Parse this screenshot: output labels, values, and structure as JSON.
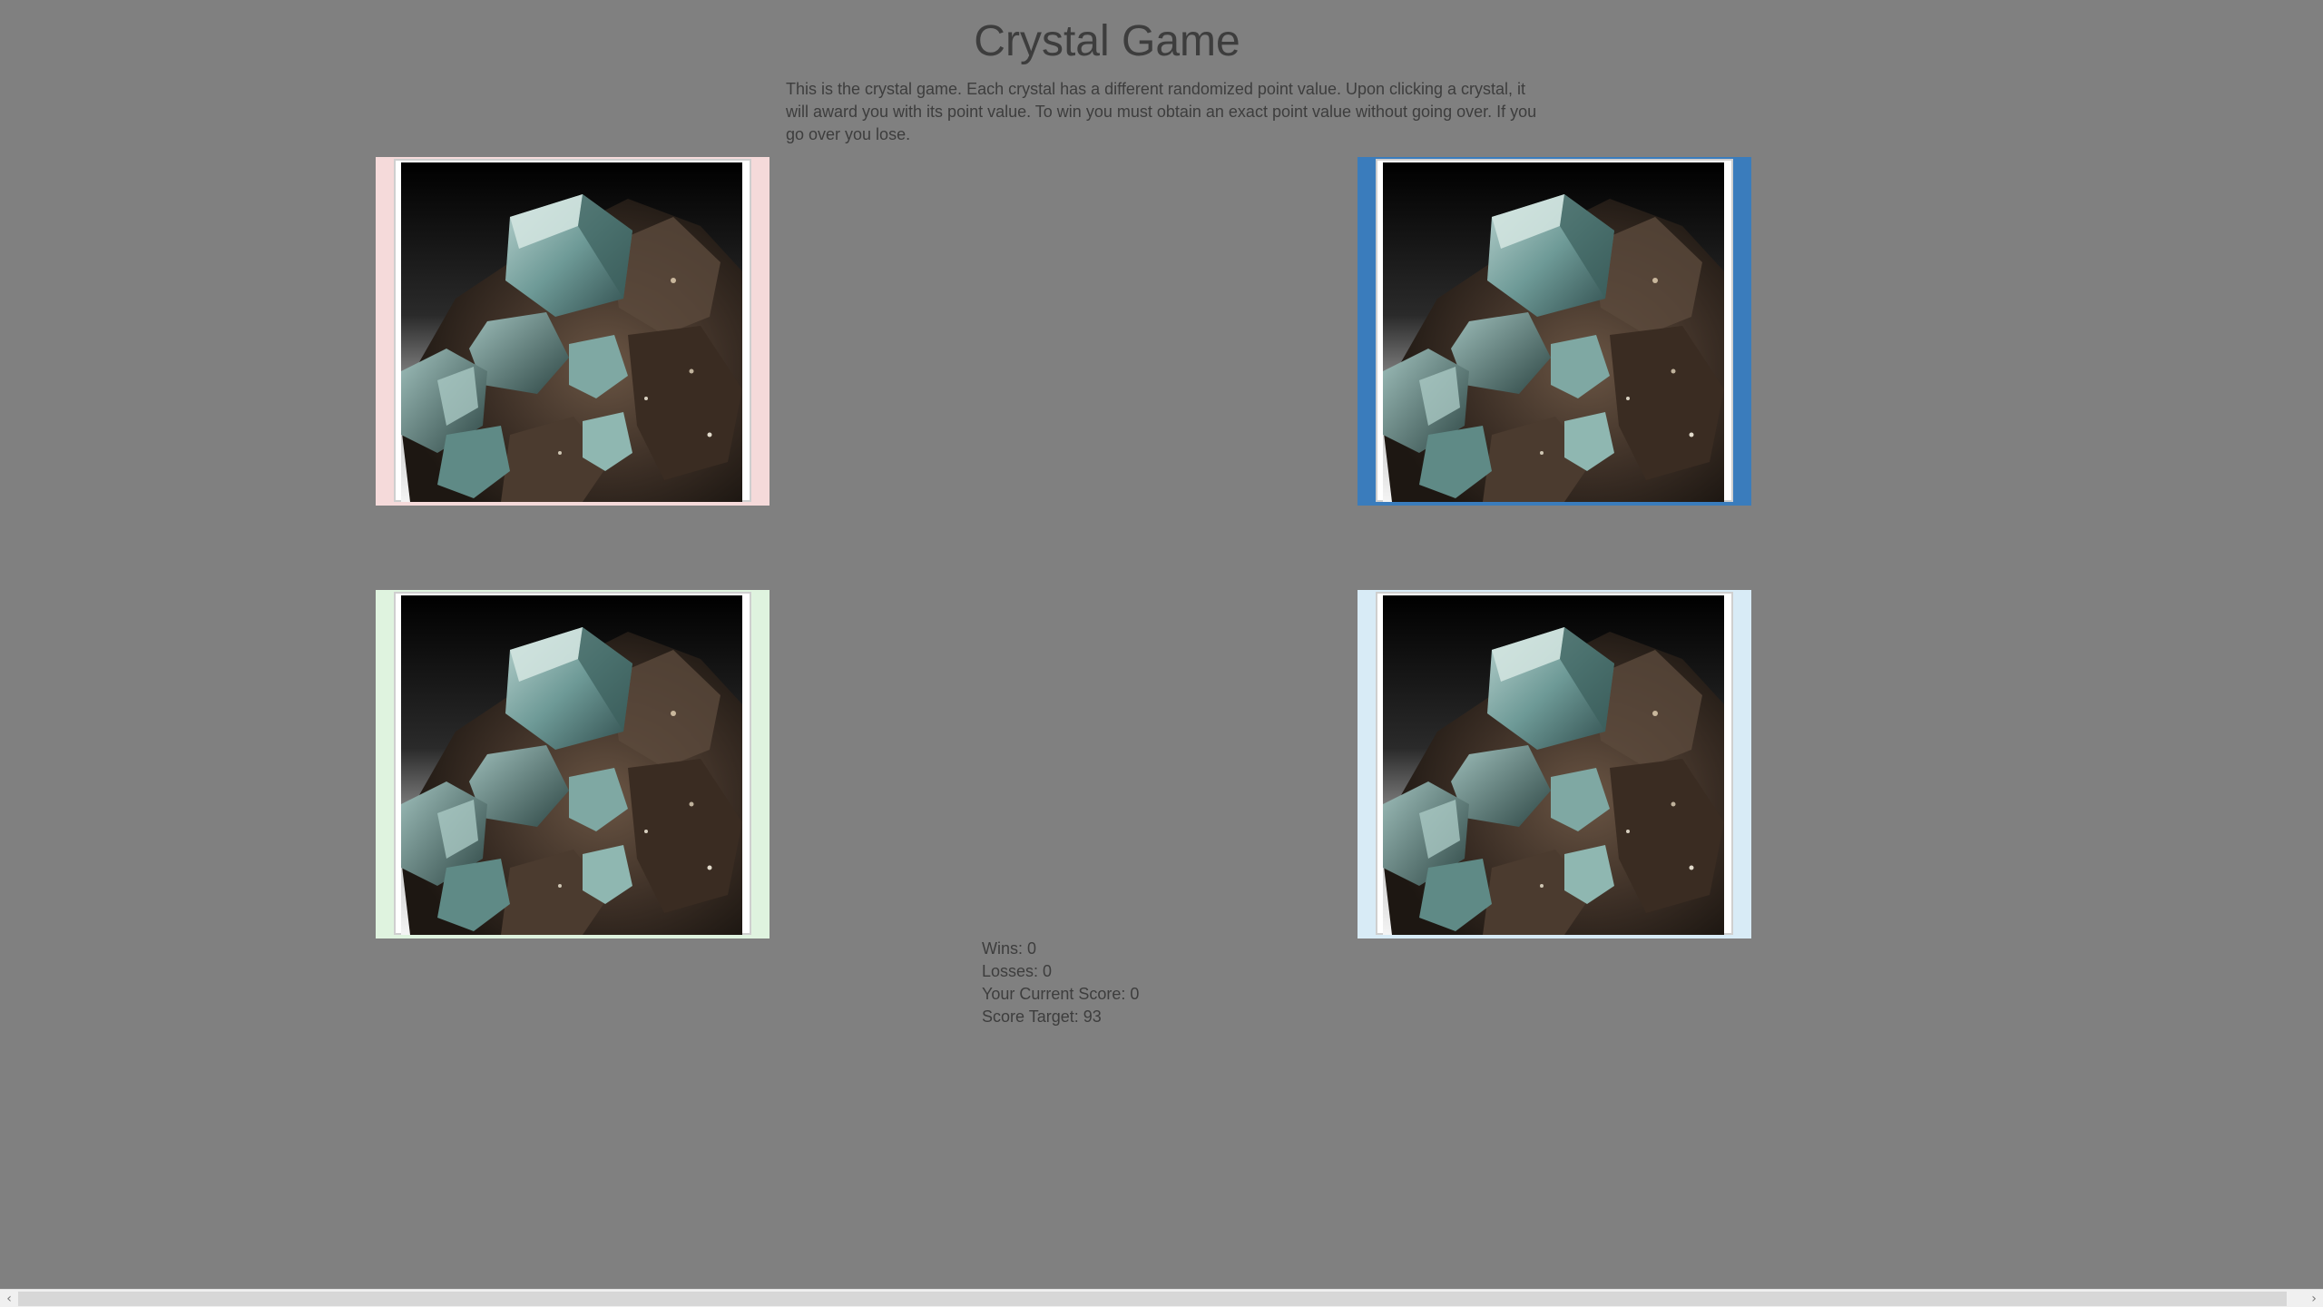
{
  "title": "Crystal Game",
  "description": "This is the crystal game. Each crystal has a different randomized point value. Upon clicking a crystal, it will award you with its point value. To win you must obtain an exact point value without going over. If you go over you lose.",
  "crystals": [
    {
      "name": "crystal-1",
      "frame_color": "#f5dada"
    },
    {
      "name": "crystal-2",
      "frame_color": "#3a7cbc"
    },
    {
      "name": "crystal-3",
      "frame_color": "#dff3df"
    },
    {
      "name": "crystal-4",
      "frame_color": "#d8ebf6"
    }
  ],
  "stats": {
    "wins_label": "Wins: 0",
    "losses_label": "Losses: 0",
    "current_score_label": "Your Current Score: 0",
    "target_label": "Score Target: 93"
  },
  "scrollbar": {
    "left_arrow": "‹",
    "right_arrow": "›"
  }
}
